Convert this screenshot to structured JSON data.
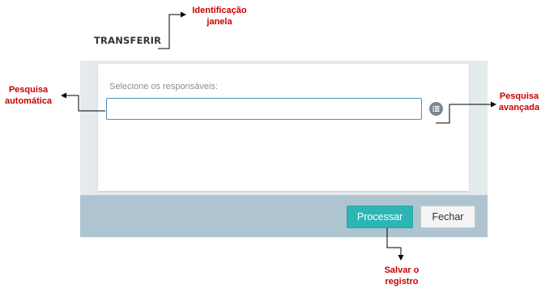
{
  "window": {
    "title": "TRANSFERIR"
  },
  "form": {
    "label": "Selecione os responsáveis:",
    "input_value": "",
    "input_placeholder": ""
  },
  "icons": {
    "advanced_search": "list-icon"
  },
  "buttons": {
    "process": "Processar",
    "close": "Fechar"
  },
  "annotations": {
    "window_id_line1": "Identificação",
    "window_id_line2": "janela",
    "auto_search_line1": "Pesquisa",
    "auto_search_line2": "automática",
    "advanced_search_line1": "Pesquisa",
    "advanced_search_line2": "avançada",
    "save_line1": "Salvar o",
    "save_line2": "registro"
  },
  "colors": {
    "annotation": "#cc0000",
    "primary_button": "#2cb5b5",
    "footer": "#aec5d1",
    "dialog_background": "#e5eaed",
    "input_border": "#4a90b8"
  }
}
